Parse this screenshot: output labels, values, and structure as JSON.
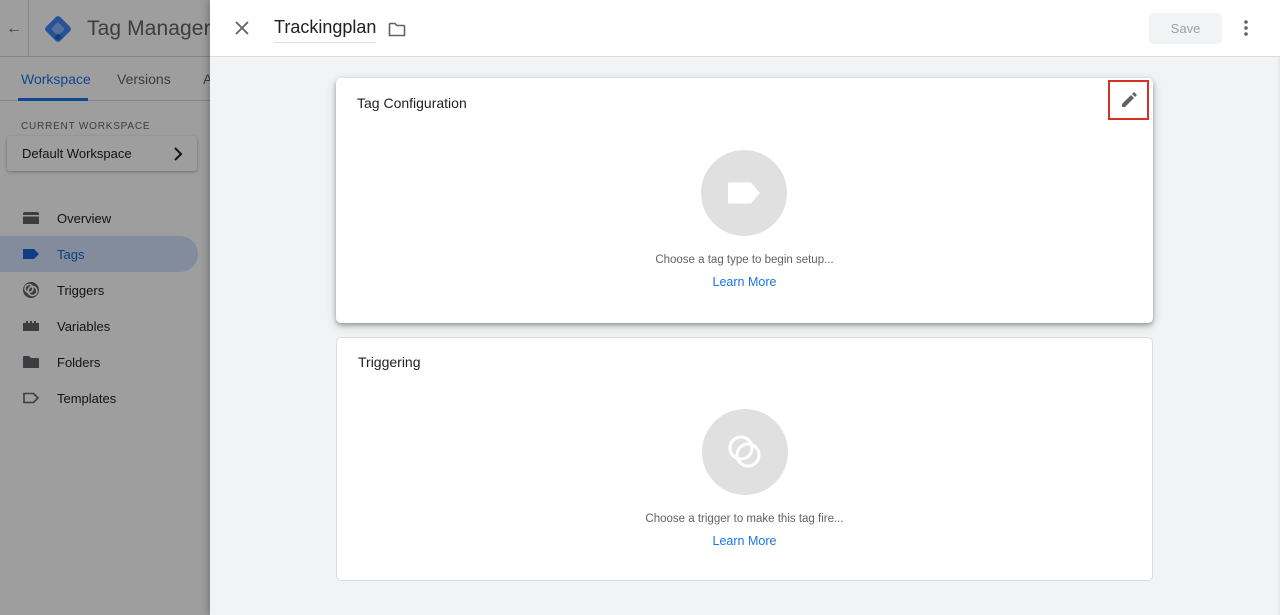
{
  "background_app": {
    "title": "Tag Manager",
    "tabs": [
      {
        "label": "Workspace",
        "active": true
      },
      {
        "label": "Versions",
        "active": false
      },
      {
        "label": "A",
        "active": false
      }
    ],
    "current_workspace_label": "CURRENT WORKSPACE",
    "workspace_name": "Default Workspace",
    "nav": [
      {
        "label": "Overview",
        "icon": "overview-icon",
        "active": false
      },
      {
        "label": "Tags",
        "icon": "tag-icon",
        "active": true
      },
      {
        "label": "Triggers",
        "icon": "trigger-icon",
        "active": false
      },
      {
        "label": "Variables",
        "icon": "variables-icon",
        "active": false
      },
      {
        "label": "Folders",
        "icon": "folder-icon",
        "active": false
      },
      {
        "label": "Templates",
        "icon": "templates-icon",
        "active": false
      }
    ]
  },
  "sheet": {
    "tag_name": "Trackingplan",
    "save_label": "Save",
    "config_card": {
      "title": "Tag Configuration",
      "hint": "Choose a tag type to begin setup...",
      "link": "Learn More"
    },
    "trigger_card": {
      "title": "Triggering",
      "hint": "Choose a trigger to make this tag fire...",
      "link": "Learn More"
    }
  },
  "colors": {
    "accent": "#1a73e8",
    "highlight_outline": "#d93025",
    "placeholder_circle": "#e0e0e0"
  }
}
